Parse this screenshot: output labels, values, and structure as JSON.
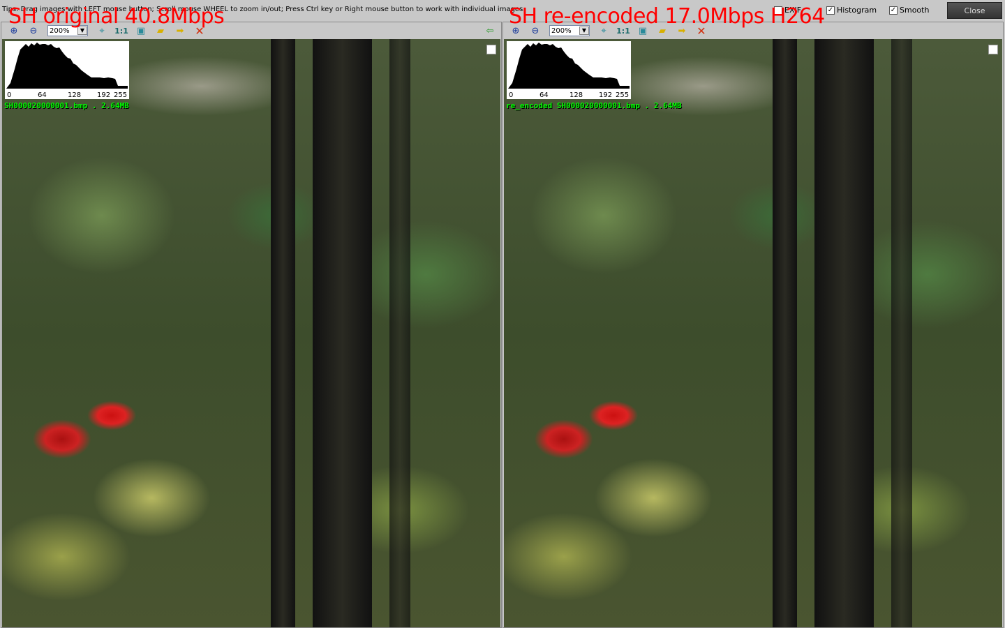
{
  "tips": "Tips: Drag images with LEFT mouse button; Scroll mouse WHEEL to zoom in/out; Press Ctrl key or Right mouse button to work with individual images.",
  "overlays": {
    "left": "SH original 40.8Mbps",
    "right": "SH re-encoded 17.0Mbps H264"
  },
  "options": {
    "exif": {
      "label": "EXIF",
      "checked": false
    },
    "histogram": {
      "label": "Histogram",
      "checked": true
    },
    "smooth": {
      "label": "Smooth",
      "checked": true
    }
  },
  "close_label": "Close",
  "panels": [
    {
      "zoom": "200%",
      "one_to_one": "1:1",
      "filename": "SH000020000001.bmp . 2.64MB",
      "hist_ticks": [
        "0",
        "64",
        "128",
        "192",
        "255"
      ]
    },
    {
      "zoom": "200%",
      "one_to_one": "1:1",
      "filename": "re_encoded SH000020000001.bmp . 2.64MB",
      "hist_ticks": [
        "0",
        "64",
        "128",
        "192",
        "255"
      ]
    }
  ],
  "icons": [
    "zoom-in-icon",
    "zoom-out-icon",
    "fit-icon",
    "actual-size-icon",
    "fullscreen-icon",
    "open-folder-icon",
    "next-folder-icon",
    "close-x-icon",
    "back-arrow-icon"
  ],
  "colors": {
    "overlay": "#ff0000",
    "filename": "#00ff00"
  }
}
